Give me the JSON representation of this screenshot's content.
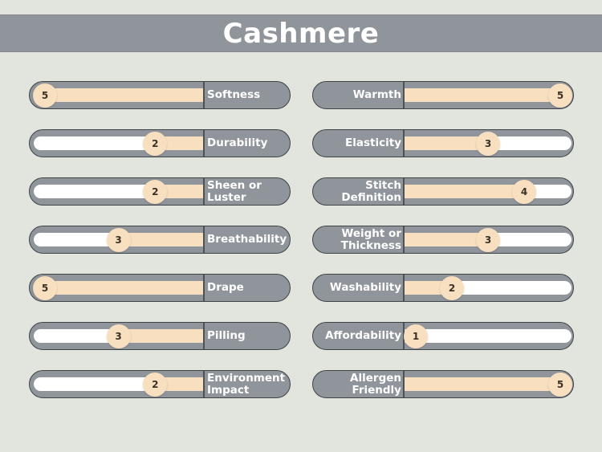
{
  "title": "Cashmere",
  "colors": {
    "background": "#e1e5de",
    "bar": "#8f959b",
    "fill": "#f7dfc0",
    "track": "#ffffff",
    "text": "#ffffff"
  },
  "chart_data": {
    "type": "bar",
    "title": "Cashmere",
    "scale": [
      1,
      5
    ],
    "left_column": [
      {
        "label": "Softness",
        "value": 5
      },
      {
        "label": "Durability",
        "value": 2
      },
      {
        "label": "Sheen or Luster",
        "value": 2
      },
      {
        "label": "Breathability",
        "value": 3
      },
      {
        "label": "Drape",
        "value": 5
      },
      {
        "label": "Pilling",
        "value": 3
      },
      {
        "label": "Environment Impact",
        "value": 2
      }
    ],
    "right_column": [
      {
        "label": "Warmth",
        "value": 5
      },
      {
        "label": "Elasticity",
        "value": 3
      },
      {
        "label": "Stitch Definition",
        "value": 4
      },
      {
        "label": "Weight or Thickness",
        "value": 3
      },
      {
        "label": "Washability",
        "value": 2
      },
      {
        "label": "Affordability",
        "value": 1
      },
      {
        "label": "Allergen Friendly",
        "value": 5
      }
    ]
  }
}
